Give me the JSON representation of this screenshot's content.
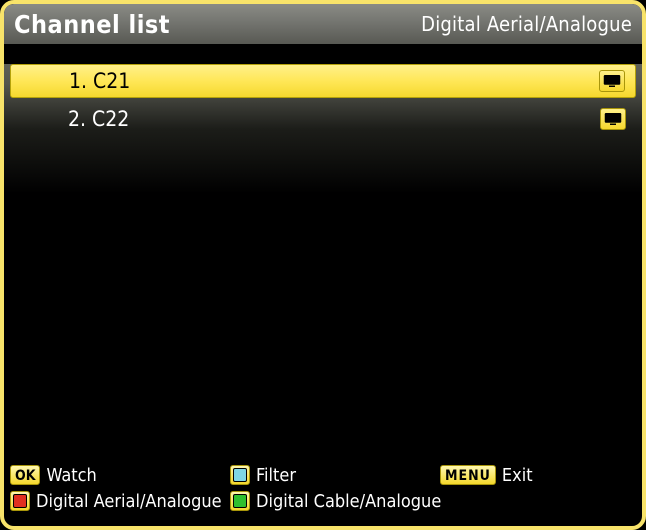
{
  "header": {
    "title": "Channel list",
    "subtitle": "Digital Aerial/Analogue"
  },
  "channels": [
    {
      "num": "1",
      "name": "C21",
      "selected": true
    },
    {
      "num": "2",
      "name": "C22",
      "selected": false
    }
  ],
  "footer": {
    "ok_label": "Watch",
    "ok_key": "OK",
    "filter_label": "Filter",
    "menu_key": "MENU",
    "menu_label": "Exit",
    "red_label": "Digital Aerial/Analogue",
    "green_label": "Digital Cable/Analogue"
  }
}
